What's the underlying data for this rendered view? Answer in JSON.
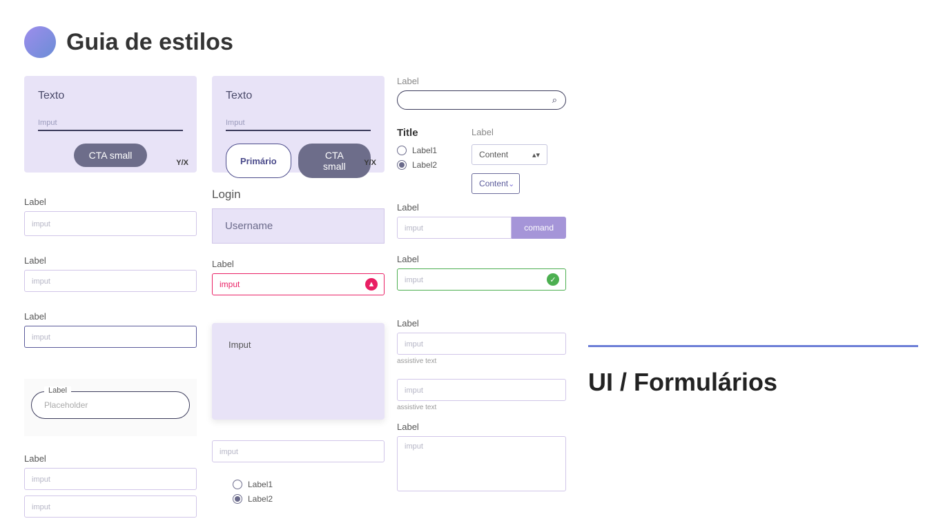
{
  "header": {
    "title": "Guia de estilos"
  },
  "card1": {
    "title": "Texto",
    "placeholder": "Imput",
    "cta": "CTA small",
    "yx": "Y/X"
  },
  "card2": {
    "title": "Texto",
    "placeholder": "Imput",
    "primary": "Primário",
    "cta": "CTA small",
    "yx": "Y/X"
  },
  "col1": {
    "f1": {
      "label": "Label",
      "ph": "imput"
    },
    "f2": {
      "label": "Label",
      "ph": "imput"
    },
    "f3": {
      "label": "Label",
      "ph": "imput"
    },
    "pill": {
      "label": "Label",
      "ph": "Placeholder"
    },
    "f4": {
      "label": "Label",
      "ph1": "imput",
      "ph2": "imput"
    }
  },
  "col2": {
    "login": {
      "title": "Login",
      "ph": "Username"
    },
    "err": {
      "label": "Label",
      "value": "imput"
    },
    "ta": {
      "value": "Imput"
    },
    "f5": {
      "ph": "imput"
    },
    "radio": {
      "l1": "Label1",
      "l2": "Label2"
    }
  },
  "col3": {
    "search": {
      "label": "Label"
    },
    "radios": {
      "title": "Title",
      "l1": "Label1",
      "l2": "Label2"
    },
    "selects": {
      "label": "Label",
      "s1": "Content",
      "s2": "Content"
    },
    "group": {
      "label": "Label",
      "ph": "imput",
      "btn": "comand"
    },
    "ok": {
      "label": "Label",
      "ph": "imput"
    },
    "assist1": {
      "label": "Label",
      "ph": "imput",
      "help": "assistive text"
    },
    "assist2": {
      "ph": "imput",
      "help": "assistive text"
    },
    "area": {
      "label": "Label",
      "ph": "imput"
    }
  },
  "section": {
    "title": "UI / Formulários"
  }
}
